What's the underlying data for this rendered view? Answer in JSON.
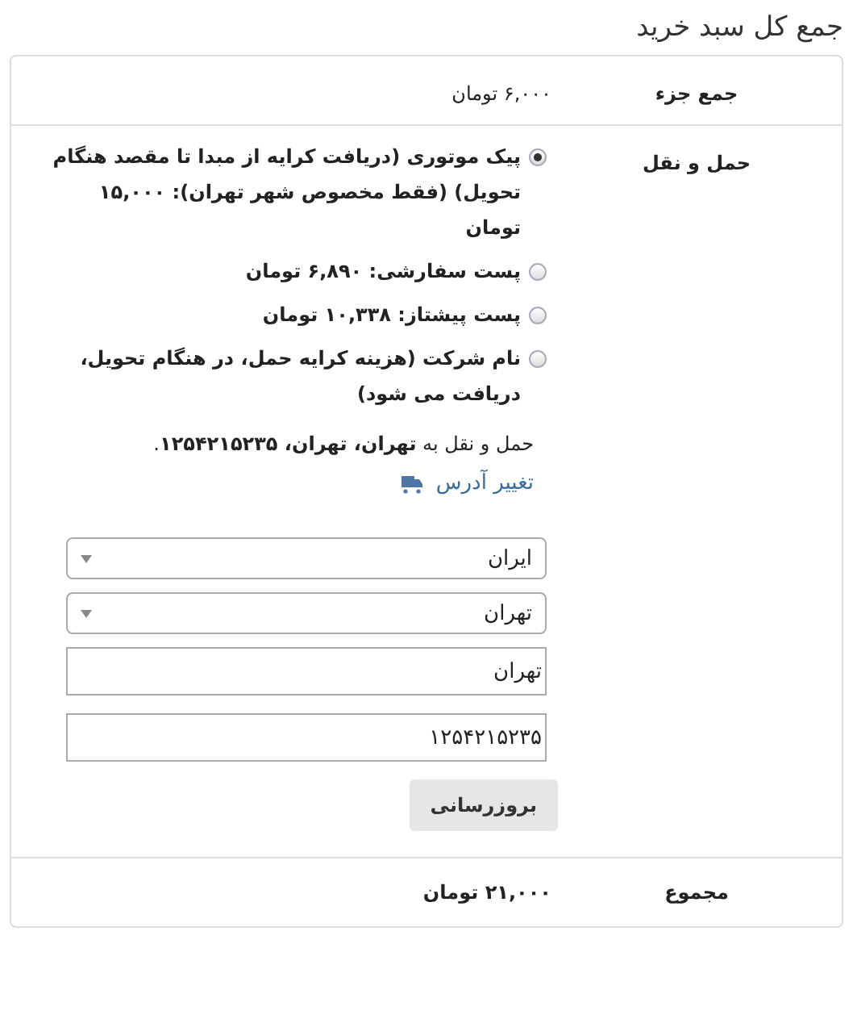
{
  "title": "جمع کل سبد خرید",
  "subtotal": {
    "label": "جمع جزء",
    "value": "۶,۰۰۰ تومان"
  },
  "shipping": {
    "label": "حمل و نقل",
    "options": [
      {
        "label": "پیک موتوری (دریافت کرایه از مبدا تا مقصد هنگام تحویل) (فقط مخصوص شهر تهران):",
        "price": "۱۵,۰۰۰ تومان",
        "selected": true
      },
      {
        "label": "پست سفارشی:",
        "price": "۶,۸۹۰ تومان",
        "selected": false
      },
      {
        "label": "پست پیشتاز:",
        "price": "۱۰,۳۳۸ تومان",
        "selected": false
      },
      {
        "label": "نام شرکت (هزینه کرایه حمل، در هنگام تحویل، دریافت می شود)",
        "selected": false
      }
    ],
    "destination": "حمل و نقل به **تهران، تهران، ۱۲۵۴۲۱۵۲۳۵**.",
    "change_address": "تغییر آدرس",
    "country": "ایران",
    "state": "تهران",
    "city": "تهران",
    "postcode": "۱۲۵۴۲۱۵۲۳۵",
    "update_button": "بروزرسانی"
  },
  "total": {
    "label": "مجموع",
    "value": "۲۱,۰۰۰ تومان"
  }
}
